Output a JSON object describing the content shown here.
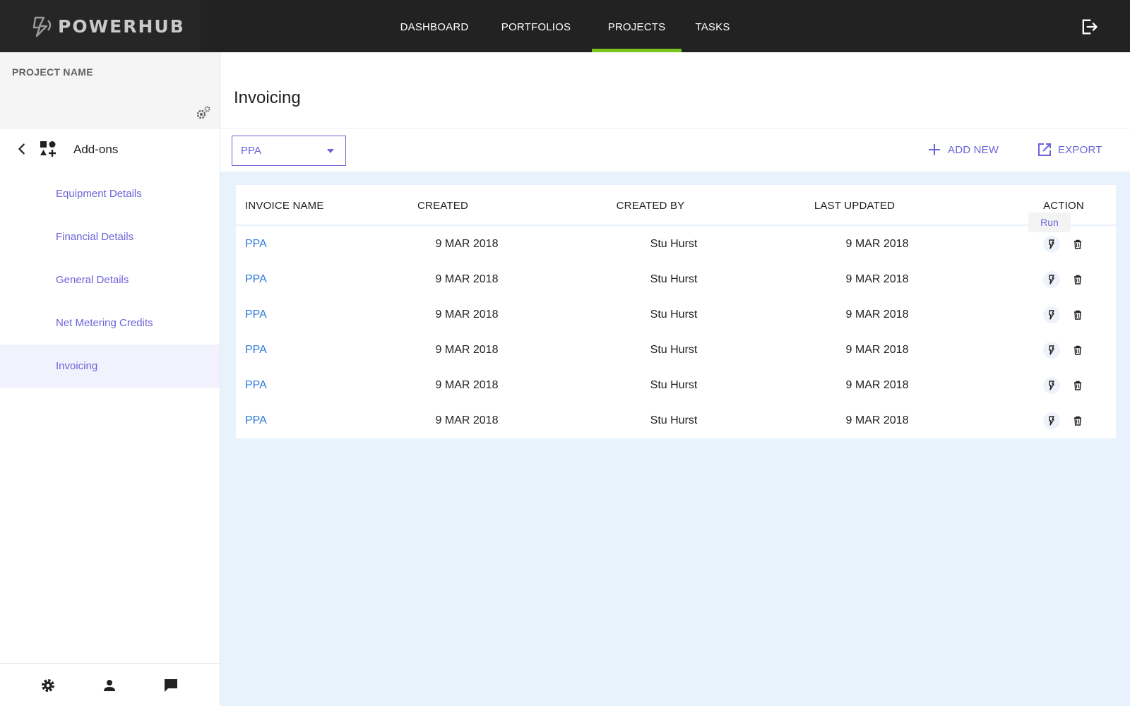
{
  "app": {
    "brand": "POWERHUB"
  },
  "nav": {
    "items": [
      {
        "label": "DASHBOARD"
      },
      {
        "label": "PORTFOLIOS"
      },
      {
        "label": "PROJECTS"
      },
      {
        "label": "TASKS"
      }
    ],
    "active": "PROJECTS"
  },
  "sidebar": {
    "project_label": "PROJECT NAME",
    "section_label": "Add-ons",
    "items": [
      {
        "label": "Equipment Details"
      },
      {
        "label": "Financial Details"
      },
      {
        "label": "General Details"
      },
      {
        "label": "Net Metering Credits"
      },
      {
        "label": "Invoicing"
      }
    ],
    "active": "Invoicing"
  },
  "page": {
    "title": "Invoicing"
  },
  "toolbar": {
    "selected_type": "PPA",
    "add_label": "ADD NEW",
    "export_label": "EXPORT"
  },
  "table": {
    "columns": [
      "INVOICE NAME",
      "CREATED",
      "CREATED BY",
      "LAST UPDATED",
      "ACTION"
    ],
    "rows": [
      {
        "name": "PPA",
        "created": "9 MAR 2018",
        "created_by": "Stu Hurst",
        "last_updated": "9 MAR 2018"
      },
      {
        "name": "PPA",
        "created": "9 MAR 2018",
        "created_by": "Stu Hurst",
        "last_updated": "9 MAR 2018"
      },
      {
        "name": "PPA",
        "created": "9 MAR 2018",
        "created_by": "Stu Hurst",
        "last_updated": "9 MAR 2018"
      },
      {
        "name": "PPA",
        "created": "9 MAR 2018",
        "created_by": "Stu Hurst",
        "last_updated": "9 MAR 2018"
      },
      {
        "name": "PPA",
        "created": "9 MAR 2018",
        "created_by": "Stu Hurst",
        "last_updated": "9 MAR 2018"
      },
      {
        "name": "PPA",
        "created": "9 MAR 2018",
        "created_by": "Stu Hurst",
        "last_updated": "9 MAR 2018"
      }
    ],
    "tooltip": "Run"
  },
  "icons": {
    "logo": "powerhub-logo-icon",
    "logout": "logout-icon",
    "settings": "gear-icon",
    "back": "chevron-left-icon",
    "addons": "shapes-icon",
    "caret": "caret-down-icon",
    "add": "plus-icon",
    "export": "open-external-icon",
    "run": "lightning-icon",
    "delete": "trash-icon",
    "footer": [
      "gear-icon",
      "person-icon",
      "chat-icon"
    ]
  },
  "colors": {
    "topbar": "#222222",
    "accent": "#6c63d8",
    "active_tab": "#7ac41e",
    "link": "#2f7ad9",
    "content_bg": "#e8f2fc"
  }
}
